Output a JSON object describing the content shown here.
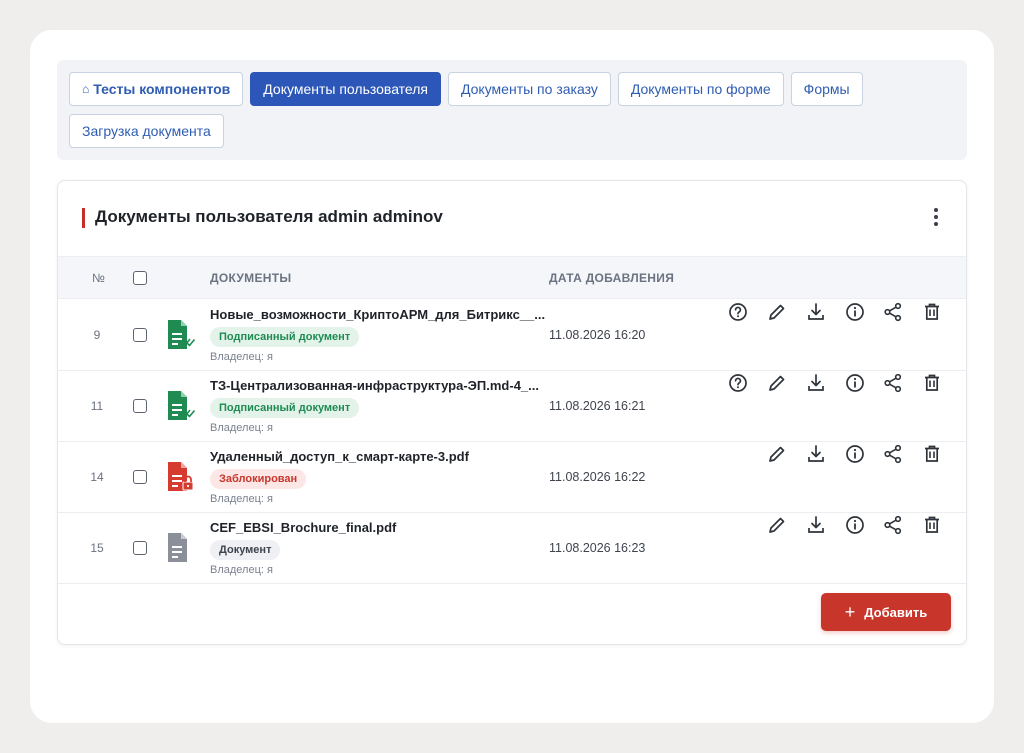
{
  "tabs": [
    {
      "label": "Тесты компонентов",
      "icon": "home-icon",
      "active": false
    },
    {
      "label": "Документы пользователя",
      "active": true
    },
    {
      "label": "Документы по заказу",
      "active": false
    },
    {
      "label": "Документы по форме",
      "active": false
    },
    {
      "label": "Формы",
      "active": false
    },
    {
      "label": "Загрузка документа",
      "active": false
    }
  ],
  "card": {
    "title": "Документы пользователя admin adminov",
    "more_icon": "kebab-menu-icon"
  },
  "table": {
    "columns": {
      "num": "№",
      "documents": "ДОКУМЕНТЫ",
      "date": "ДАТА ДОБАВЛЕНИЯ"
    },
    "rows": [
      {
        "num": "9",
        "name": "Новые_возможности_КриптоАРМ_для_Битрикс__...",
        "badge": "Подписанный документ",
        "badge_type": "signed",
        "file_icon": "signed-document-icon",
        "owner": "Владелец: я",
        "date": "11.08.2026 16:20",
        "actions": [
          "help-icon",
          "edit-icon",
          "download-icon",
          "info-icon",
          "share-icon",
          "delete-icon"
        ]
      },
      {
        "num": "11",
        "name": "ТЗ-Централизованная-инфраструктура-ЭП.md-4_...",
        "badge": "Подписанный документ",
        "badge_type": "signed",
        "file_icon": "signed-document-icon",
        "owner": "Владелец: я",
        "date": "11.08.2026 16:21",
        "actions": [
          "help-icon",
          "edit-icon",
          "download-icon",
          "info-icon",
          "share-icon",
          "delete-icon"
        ]
      },
      {
        "num": "14",
        "name": "Удаленный_доступ_к_смарт-карте-3.pdf",
        "badge": "Заблокирован",
        "badge_type": "blocked",
        "file_icon": "locked-document-icon",
        "owner": "Владелец: я",
        "date": "11.08.2026 16:22",
        "actions": [
          "edit-icon",
          "download-icon",
          "info-icon",
          "share-icon",
          "delete-icon"
        ]
      },
      {
        "num": "15",
        "name": "CEF_EBSI_Brochure_final.pdf",
        "badge": "Документ",
        "badge_type": "plain",
        "file_icon": "document-icon",
        "owner": "Владелец: я",
        "date": "11.08.2026 16:23",
        "actions": [
          "edit-icon",
          "download-icon",
          "info-icon",
          "share-icon",
          "delete-icon"
        ]
      }
    ]
  },
  "add_button": {
    "label": "Добавить",
    "icon": "plus-icon"
  },
  "colors": {
    "accent_blue": "#2c57b8",
    "accent_red": "#c8352b",
    "signed_green": "#1f8a52",
    "blocked_red": "#c6372c",
    "doc_gray": "#8a8f99"
  }
}
